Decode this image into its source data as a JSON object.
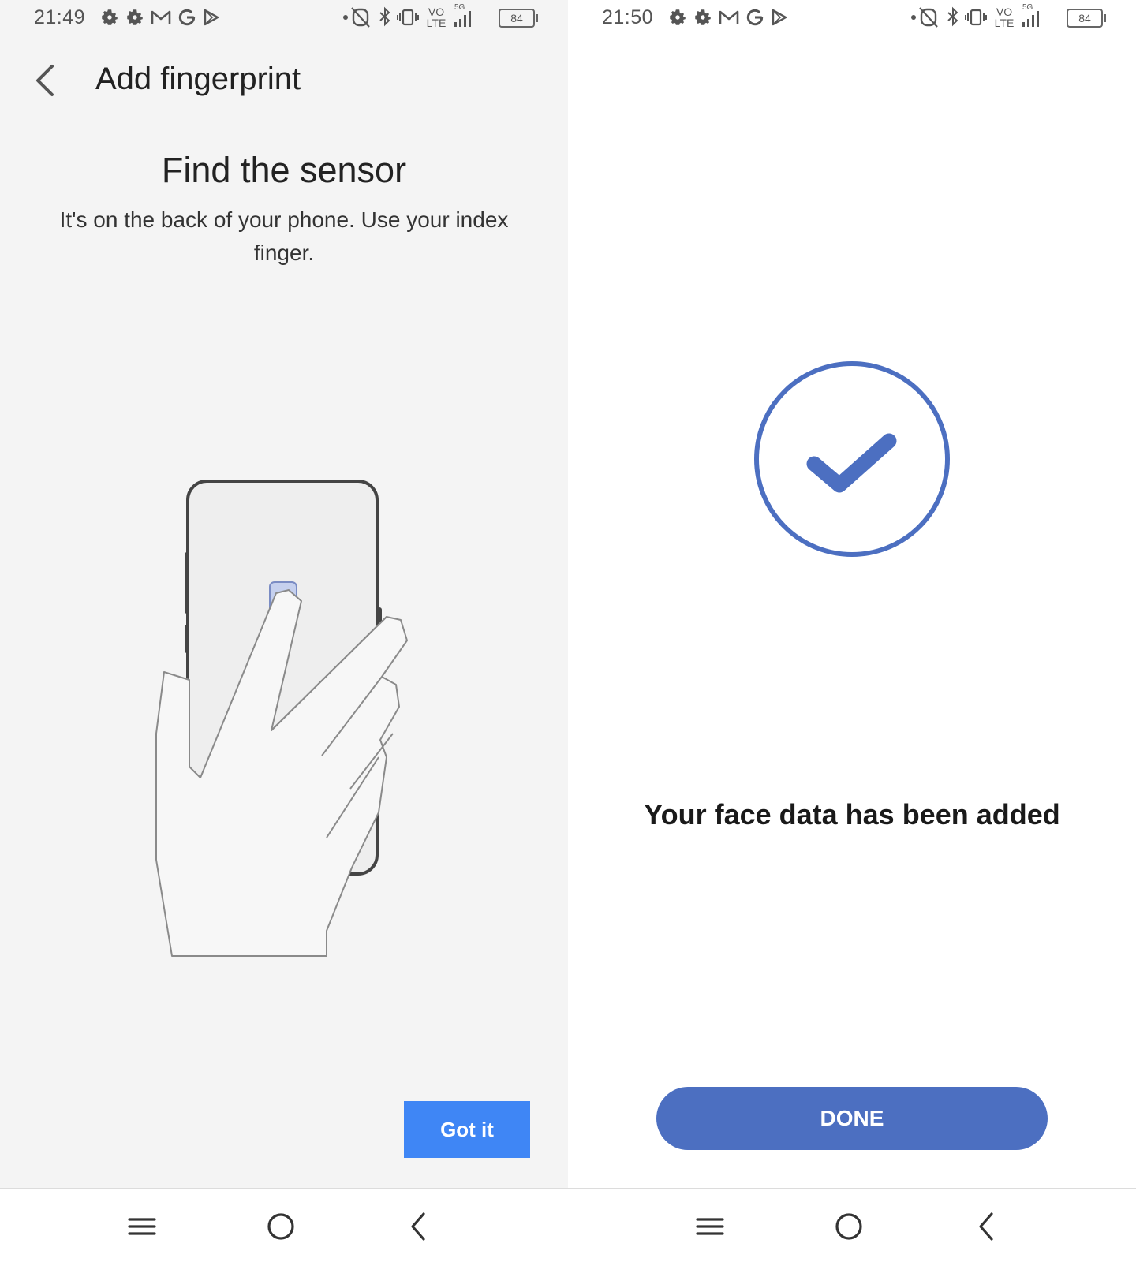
{
  "left": {
    "status": {
      "time": "21:49",
      "battery": "84",
      "network_badge_top": "VO",
      "network_badge_bottom": "LTE",
      "network_5g": "5G"
    },
    "appbar": {
      "title": "Add fingerprint"
    },
    "heading": "Find the sensor",
    "subtext": "It's on the back of your phone. Use your index finger.",
    "button_label": "Got it"
  },
  "right": {
    "status": {
      "time": "21:50",
      "battery": "84",
      "network_badge_top": "VO",
      "network_badge_bottom": "LTE",
      "network_5g": "5G"
    },
    "message": "Your face data has been added",
    "button_label": "DONE"
  },
  "icons": {
    "status_app": [
      "settings-icon",
      "settings-icon",
      "gmail-icon",
      "google-icon",
      "play-store-icon"
    ],
    "status_sys": [
      "nfc-icon",
      "bluetooth-icon",
      "vibrate-icon",
      "volte-icon",
      "signal-icon",
      "battery-icon"
    ],
    "nav": [
      "menu-icon",
      "home-icon",
      "back-icon"
    ]
  },
  "colors": {
    "accent_left": "#3f86f5",
    "accent_right": "#4c6fc1",
    "left_background": "#f4f4f4"
  }
}
